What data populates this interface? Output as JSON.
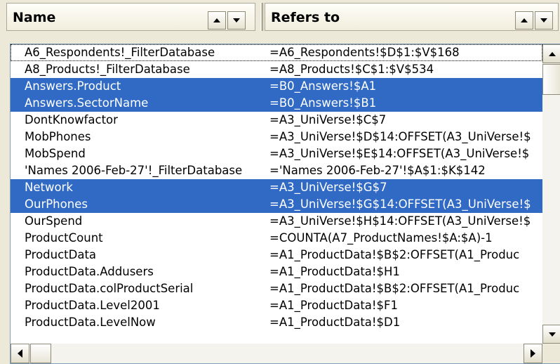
{
  "header": {
    "name_label": "Name",
    "refers_label": "Refers to"
  },
  "rows": [
    {
      "name": "A6_Respondents!_FilterDatabase",
      "ref": "=A6_Respondents!$D$1:$V$168",
      "selected": false,
      "focused": true
    },
    {
      "name": "A8_Products!_FilterDatabase",
      "ref": "=A8_Products!$C$1:$V$534",
      "selected": false
    },
    {
      "name": "Answers.Product",
      "ref": "=B0_Answers!$A1",
      "selected": true
    },
    {
      "name": "Answers.SectorName",
      "ref": "=B0_Answers!$B1",
      "selected": true
    },
    {
      "name": "DontKnowfactor",
      "ref": "=A3_UniVerse!$C$7",
      "selected": false
    },
    {
      "name": "MobPhones",
      "ref": "=A3_UniVerse!$D$14:OFFSET(A3_UniVerse!$",
      "selected": false
    },
    {
      "name": "MobSpend",
      "ref": "=A3_UniVerse!$E$14:OFFSET(A3_UniVerse!$",
      "selected": false
    },
    {
      "name": "'Names 2006-Feb-27'!_FilterDatabase",
      "ref": "='Names 2006-Feb-27'!$A$1:$K$142",
      "selected": false
    },
    {
      "name": "Network",
      "ref": "=A3_UniVerse!$G$7",
      "selected": true
    },
    {
      "name": "OurPhones",
      "ref": "=A3_UniVerse!$G$14:OFFSET(A3_UniVerse!$",
      "selected": true
    },
    {
      "name": "OurSpend",
      "ref": "=A3_UniVerse!$H$14:OFFSET(A3_UniVerse!$",
      "selected": false
    },
    {
      "name": "ProductCount",
      "ref": "=COUNTA(A7_ProductNames!$A:$A)-1",
      "selected": false
    },
    {
      "name": "ProductData",
      "ref": "=A1_ProductData!$B$2:OFFSET(A1_Produc",
      "selected": false
    },
    {
      "name": "ProductData.Addusers",
      "ref": "=A1_ProductData!$H1",
      "selected": false
    },
    {
      "name": "ProductData.colProductSerial",
      "ref": "=A1_ProductData!$B$2:OFFSET(A1_Produc",
      "selected": false
    },
    {
      "name": "ProductData.Level2001",
      "ref": "=A1_ProductData!$F1",
      "selected": false
    },
    {
      "name": "ProductData.LevelNow",
      "ref": "=A1_ProductData!$D1",
      "selected": false
    }
  ],
  "icons": {
    "sort_up": "triangle-up-icon",
    "sort_down": "triangle-down-icon",
    "scroll_up": "triangle-up-icon",
    "scroll_down": "triangle-down-icon",
    "scroll_left": "triangle-left-icon",
    "scroll_right": "triangle-right-icon"
  },
  "colors": {
    "selection": "#316ac5",
    "selection_text": "#ffffff"
  }
}
